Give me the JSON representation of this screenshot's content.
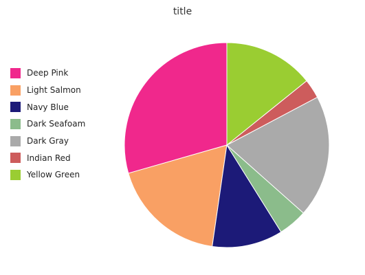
{
  "chart_data": {
    "type": "pie",
    "title": "title",
    "legend_position": "left",
    "start_angle_deg": -90,
    "direction": "counterclockwise",
    "slices": [
      {
        "label": "Deep Pink",
        "value": 29,
        "color": "#f0288c"
      },
      {
        "label": "Light Salmon",
        "value": 18,
        "color": "#f9a064"
      },
      {
        "label": "Navy Blue",
        "value": 11,
        "color": "#1c1a78"
      },
      {
        "label": "Dark Seafoam",
        "value": 4.5,
        "color": "#8bbc8b"
      },
      {
        "label": "Dark Gray",
        "value": 19,
        "color": "#aaaaaa"
      },
      {
        "label": "Indian Red",
        "value": 3,
        "color": "#cd5c5c"
      },
      {
        "label": "Yellow Green",
        "value": 14,
        "color": "#9acd32"
      }
    ]
  }
}
